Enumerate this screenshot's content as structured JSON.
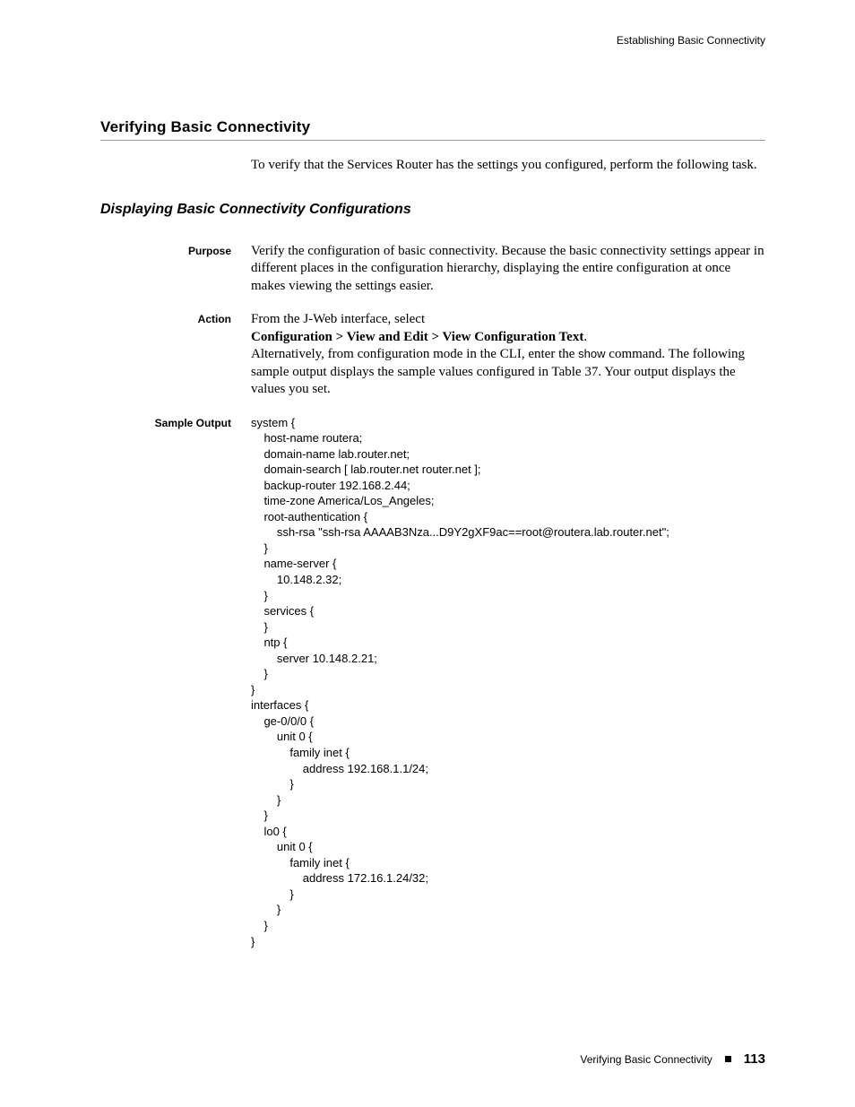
{
  "runningHead": "Establishing Basic Connectivity",
  "sectionTitle": "Verifying Basic Connectivity",
  "intro": "To verify that the Services Router has the settings you configured, perform the following task.",
  "subsectionTitle": "Displaying Basic Connectivity Configurations",
  "labels": {
    "purpose": "Purpose",
    "action": "Action",
    "sampleOutput": "Sample Output"
  },
  "purpose": "Verify the configuration of basic connectivity. Because the basic connectivity settings appear in different places in the configuration hierarchy, displaying the entire configuration at once makes viewing the settings easier.",
  "action": {
    "line1": "From the J-Web interface, select",
    "path": "Configuration > View and Edit > View Configuration Text",
    "period": ".",
    "line2a": "Alternatively, from configuration mode in the CLI, enter the ",
    "cmd": "show",
    "line2b": " command. The following sample output displays the sample values configured in Table 37. Your output displays the values you set."
  },
  "sample": "system {\n    host-name routera;\n    domain-name lab.router.net;\n    domain-search [ lab.router.net router.net ];\n    backup-router 192.168.2.44;\n    time-zone America/Los_Angeles;\n    root-authentication {\n        ssh-rsa \"ssh-rsa AAAAB3Nza...D9Y2gXF9ac==root@routera.lab.router.net\";\n    }\n    name-server {\n        10.148.2.32;\n    }\n    services {\n    }\n    ntp {\n        server 10.148.2.21;\n    }\n}\ninterfaces {\n    ge-0/0/0 {\n        unit 0 {\n            family inet {\n                address 192.168.1.1/24;\n            }\n        }\n    }\n    lo0 {\n        unit 0 {\n            family inet {\n                address 172.16.1.24/32;\n            }\n        }\n    }\n}",
  "footer": {
    "text": "Verifying Basic Connectivity",
    "page": "113"
  }
}
